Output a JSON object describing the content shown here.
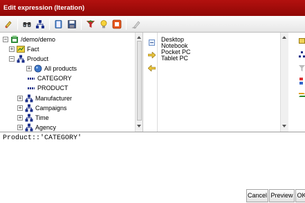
{
  "window": {
    "title": "Edit expression (Iteration)"
  },
  "toolbar": {
    "icons": [
      "back-icon",
      "binoculars-icon",
      "hierarchy-icon",
      "book-icon",
      "save-icon",
      "filter-icon",
      "lightbulb-icon",
      "record-icon",
      "eraser-icon"
    ]
  },
  "tree": {
    "root": "/demo/demo",
    "items": [
      {
        "label": "Fact"
      },
      {
        "label": "Product"
      },
      {
        "label": "All products"
      },
      {
        "label": "CATEGORY"
      },
      {
        "label": "PRODUCT"
      },
      {
        "label": "Manufacturer"
      },
      {
        "label": "Campaigns"
      },
      {
        "label": "Time"
      },
      {
        "label": "Agency"
      }
    ]
  },
  "values": [
    "Desktop",
    "Notebook",
    "Pocket PC",
    "Tablet PC"
  ],
  "expression": "Product::'CATEGORY'",
  "buttons": {
    "cancel": "Cancel",
    "preview": "Preview",
    "ok": "OK"
  },
  "colors": {
    "titlebar": "#a00f0d",
    "hierarchy_blue": "#1b2f8a"
  }
}
